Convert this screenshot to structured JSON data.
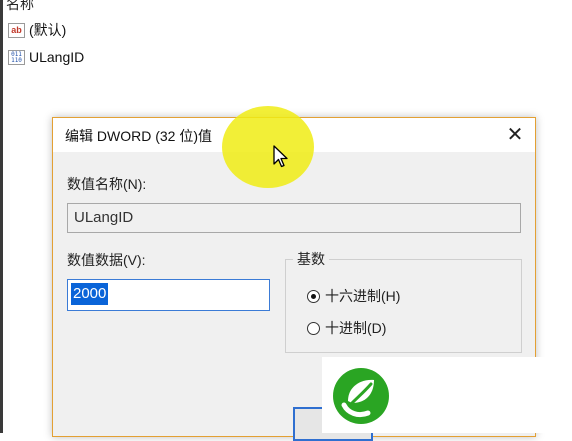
{
  "background_list": {
    "column_header": "名称",
    "rows": [
      {
        "icon": "string-value-icon",
        "label": "(默认)",
        "icon_text": "ab"
      },
      {
        "icon": "binary-value-icon",
        "label": "ULangID",
        "icon_text": "011 110"
      }
    ]
  },
  "dialog": {
    "title": "编辑 DWORD (32 位)值",
    "close_glyph": "✕",
    "value_name_label": "数值名称(N):",
    "value_name": "ULangID",
    "value_data_label": "数值数据(V):",
    "value_data": "2000",
    "base": {
      "title": "基数",
      "options": [
        {
          "label": "十六进制(H)",
          "selected": true
        },
        {
          "label": "十进制(D)",
          "selected": false
        }
      ]
    }
  },
  "colors": {
    "dialog_border": "#e3a033",
    "selection": "#0a64d8",
    "highlight": "#f0ec14",
    "logo_green": "#2aa523"
  }
}
